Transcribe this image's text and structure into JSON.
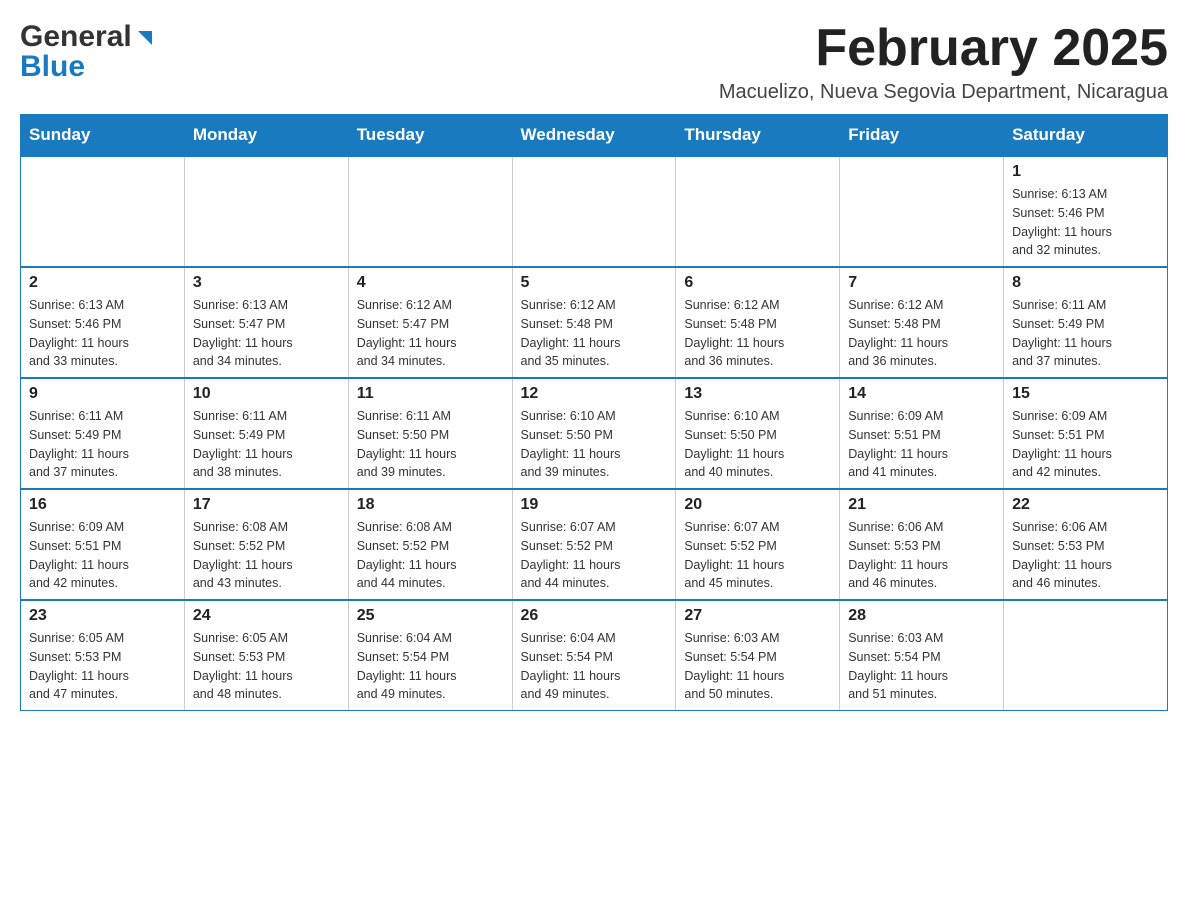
{
  "header": {
    "logo_line1": "General",
    "logo_line2": "Blue",
    "title": "February 2025",
    "subtitle": "Macuelizo, Nueva Segovia Department, Nicaragua"
  },
  "calendar": {
    "days_of_week": [
      "Sunday",
      "Monday",
      "Tuesday",
      "Wednesday",
      "Thursday",
      "Friday",
      "Saturday"
    ],
    "weeks": [
      [
        {
          "day": "",
          "info": ""
        },
        {
          "day": "",
          "info": ""
        },
        {
          "day": "",
          "info": ""
        },
        {
          "day": "",
          "info": ""
        },
        {
          "day": "",
          "info": ""
        },
        {
          "day": "",
          "info": ""
        },
        {
          "day": "1",
          "info": "Sunrise: 6:13 AM\nSunset: 5:46 PM\nDaylight: 11 hours\nand 32 minutes."
        }
      ],
      [
        {
          "day": "2",
          "info": "Sunrise: 6:13 AM\nSunset: 5:46 PM\nDaylight: 11 hours\nand 33 minutes."
        },
        {
          "day": "3",
          "info": "Sunrise: 6:13 AM\nSunset: 5:47 PM\nDaylight: 11 hours\nand 34 minutes."
        },
        {
          "day": "4",
          "info": "Sunrise: 6:12 AM\nSunset: 5:47 PM\nDaylight: 11 hours\nand 34 minutes."
        },
        {
          "day": "5",
          "info": "Sunrise: 6:12 AM\nSunset: 5:48 PM\nDaylight: 11 hours\nand 35 minutes."
        },
        {
          "day": "6",
          "info": "Sunrise: 6:12 AM\nSunset: 5:48 PM\nDaylight: 11 hours\nand 36 minutes."
        },
        {
          "day": "7",
          "info": "Sunrise: 6:12 AM\nSunset: 5:48 PM\nDaylight: 11 hours\nand 36 minutes."
        },
        {
          "day": "8",
          "info": "Sunrise: 6:11 AM\nSunset: 5:49 PM\nDaylight: 11 hours\nand 37 minutes."
        }
      ],
      [
        {
          "day": "9",
          "info": "Sunrise: 6:11 AM\nSunset: 5:49 PM\nDaylight: 11 hours\nand 37 minutes."
        },
        {
          "day": "10",
          "info": "Sunrise: 6:11 AM\nSunset: 5:49 PM\nDaylight: 11 hours\nand 38 minutes."
        },
        {
          "day": "11",
          "info": "Sunrise: 6:11 AM\nSunset: 5:50 PM\nDaylight: 11 hours\nand 39 minutes."
        },
        {
          "day": "12",
          "info": "Sunrise: 6:10 AM\nSunset: 5:50 PM\nDaylight: 11 hours\nand 39 minutes."
        },
        {
          "day": "13",
          "info": "Sunrise: 6:10 AM\nSunset: 5:50 PM\nDaylight: 11 hours\nand 40 minutes."
        },
        {
          "day": "14",
          "info": "Sunrise: 6:09 AM\nSunset: 5:51 PM\nDaylight: 11 hours\nand 41 minutes."
        },
        {
          "day": "15",
          "info": "Sunrise: 6:09 AM\nSunset: 5:51 PM\nDaylight: 11 hours\nand 42 minutes."
        }
      ],
      [
        {
          "day": "16",
          "info": "Sunrise: 6:09 AM\nSunset: 5:51 PM\nDaylight: 11 hours\nand 42 minutes."
        },
        {
          "day": "17",
          "info": "Sunrise: 6:08 AM\nSunset: 5:52 PM\nDaylight: 11 hours\nand 43 minutes."
        },
        {
          "day": "18",
          "info": "Sunrise: 6:08 AM\nSunset: 5:52 PM\nDaylight: 11 hours\nand 44 minutes."
        },
        {
          "day": "19",
          "info": "Sunrise: 6:07 AM\nSunset: 5:52 PM\nDaylight: 11 hours\nand 44 minutes."
        },
        {
          "day": "20",
          "info": "Sunrise: 6:07 AM\nSunset: 5:52 PM\nDaylight: 11 hours\nand 45 minutes."
        },
        {
          "day": "21",
          "info": "Sunrise: 6:06 AM\nSunset: 5:53 PM\nDaylight: 11 hours\nand 46 minutes."
        },
        {
          "day": "22",
          "info": "Sunrise: 6:06 AM\nSunset: 5:53 PM\nDaylight: 11 hours\nand 46 minutes."
        }
      ],
      [
        {
          "day": "23",
          "info": "Sunrise: 6:05 AM\nSunset: 5:53 PM\nDaylight: 11 hours\nand 47 minutes."
        },
        {
          "day": "24",
          "info": "Sunrise: 6:05 AM\nSunset: 5:53 PM\nDaylight: 11 hours\nand 48 minutes."
        },
        {
          "day": "25",
          "info": "Sunrise: 6:04 AM\nSunset: 5:54 PM\nDaylight: 11 hours\nand 49 minutes."
        },
        {
          "day": "26",
          "info": "Sunrise: 6:04 AM\nSunset: 5:54 PM\nDaylight: 11 hours\nand 49 minutes."
        },
        {
          "day": "27",
          "info": "Sunrise: 6:03 AM\nSunset: 5:54 PM\nDaylight: 11 hours\nand 50 minutes."
        },
        {
          "day": "28",
          "info": "Sunrise: 6:03 AM\nSunset: 5:54 PM\nDaylight: 11 hours\nand 51 minutes."
        },
        {
          "day": "",
          "info": ""
        }
      ]
    ]
  }
}
